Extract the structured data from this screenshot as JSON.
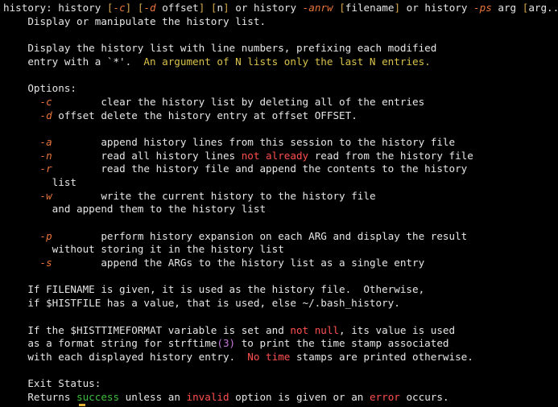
{
  "colors": {
    "background": "#000000",
    "text": "#e6e6e6",
    "option": "#e8743b",
    "bracket": "#d4a64a",
    "negative": "#ff4f4f",
    "success": "#3fbf3f",
    "highlight": "#d8c24a",
    "cursor": "#e0b030"
  },
  "lines": [
    [
      {
        "t": "history: history "
      },
      {
        "t": "[",
        "c": "brk"
      },
      {
        "t": "-c",
        "c": "opt"
      },
      {
        "t": "]",
        "c": "brk"
      },
      {
        "t": " "
      },
      {
        "t": "[",
        "c": "brk"
      },
      {
        "t": "-d",
        "c": "opt"
      },
      {
        "t": " offset"
      },
      {
        "t": "]",
        "c": "brk"
      },
      {
        "t": " "
      },
      {
        "t": "[",
        "c": "brk"
      },
      {
        "t": "n"
      },
      {
        "t": "]",
        "c": "brk"
      },
      {
        "t": " or history "
      },
      {
        "t": "-anrw",
        "c": "opt"
      },
      {
        "t": " "
      },
      {
        "t": "[",
        "c": "brk"
      },
      {
        "t": "filename"
      },
      {
        "t": "]",
        "c": "brk"
      },
      {
        "t": " or history "
      },
      {
        "t": "-ps",
        "c": "opt"
      },
      {
        "t": " arg "
      },
      {
        "t": "[",
        "c": "brk"
      },
      {
        "t": "arg..."
      },
      {
        "t": "]",
        "c": "brk"
      }
    ],
    [
      {
        "t": "    Display or manipulate the history list."
      }
    ],
    [],
    [
      {
        "t": "    Display the history list with line numbers, prefixing each modified"
      }
    ],
    [
      {
        "t": "    entry with a `*'.  "
      },
      {
        "t": "An argument of N lists only the last N entries.",
        "c": "ylw"
      }
    ],
    [],
    [
      {
        "t": "    Options:"
      }
    ],
    [
      {
        "t": "      "
      },
      {
        "t": "-c",
        "c": "opt"
      },
      {
        "t": "        clear the history list by deleting all of the entries"
      }
    ],
    [
      {
        "t": "      "
      },
      {
        "t": "-d",
        "c": "opt"
      },
      {
        "t": " offset delete the history entry at offset OFFSET."
      }
    ],
    [],
    [
      {
        "t": "      "
      },
      {
        "t": "-a",
        "c": "opt"
      },
      {
        "t": "        append history lines from this session to the history file"
      }
    ],
    [
      {
        "t": "      "
      },
      {
        "t": "-n",
        "c": "opt"
      },
      {
        "t": "        read all history lines "
      },
      {
        "t": "not already",
        "c": "red"
      },
      {
        "t": " read from the history file"
      }
    ],
    [
      {
        "t": "      "
      },
      {
        "t": "-r",
        "c": "opt"
      },
      {
        "t": "        read the history file and append the contents to the history"
      }
    ],
    [
      {
        "t": "        list"
      }
    ],
    [
      {
        "t": "      "
      },
      {
        "t": "-w",
        "c": "opt"
      },
      {
        "t": "        write the current history to the history file"
      }
    ],
    [
      {
        "t": "        and append them to the history list"
      }
    ],
    [],
    [
      {
        "t": "      "
      },
      {
        "t": "-p",
        "c": "opt"
      },
      {
        "t": "        perform history expansion on each ARG and display the result"
      }
    ],
    [
      {
        "t": "        without storing it in the history list"
      }
    ],
    [
      {
        "t": "      "
      },
      {
        "t": "-s",
        "c": "opt"
      },
      {
        "t": "        append the ARGs to the history list as a single entry"
      }
    ],
    [],
    [
      {
        "t": "    If FILENAME is given, it is used as the history file.  Otherwise,"
      }
    ],
    [
      {
        "t": "    if $HISTFILE has a value, that is used, else ~/.bash_history."
      }
    ],
    [],
    [
      {
        "t": "    If the $HISTTIMEFORMAT variable is set and "
      },
      {
        "t": "not null",
        "c": "red"
      },
      {
        "t": ", its value is used"
      }
    ],
    [
      {
        "t": "    as a format string for strftime"
      },
      {
        "t": "(3)",
        "c": "mag"
      },
      {
        "t": " to print the time stamp associated"
      }
    ],
    [
      {
        "t": "    with each displayed history entry.  "
      },
      {
        "t": "No time",
        "c": "red"
      },
      {
        "t": " stamps are printed otherwise."
      }
    ],
    [],
    [
      {
        "t": "    Exit Status:"
      }
    ],
    [
      {
        "t": "    Returns "
      },
      {
        "t": "success",
        "c": "grn"
      },
      {
        "t": " unless an "
      },
      {
        "t": "invalid",
        "c": "red"
      },
      {
        "t": " option is given or an "
      },
      {
        "t": "error",
        "c": "red"
      },
      {
        "t": " occurs."
      }
    ]
  ]
}
